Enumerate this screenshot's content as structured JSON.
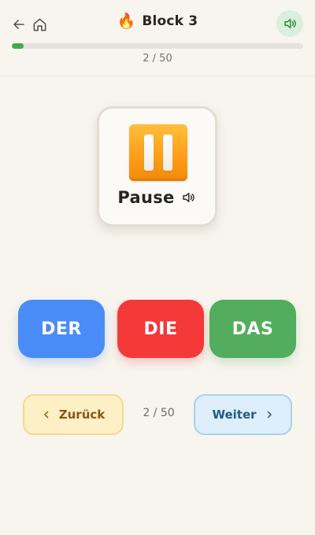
{
  "header": {
    "back_icon": "arrow-left-icon",
    "home_icon": "home-icon",
    "title_emoji": "🔥",
    "title": "Block 3",
    "sound_icon": "speaker-icon",
    "progress_fraction": 0.04,
    "progress_text": "2 / 50"
  },
  "card": {
    "image": "pause-button-emoji",
    "word": "Pause",
    "sound_icon": "speaker-icon"
  },
  "articles": {
    "der": "DER",
    "die": "DIE",
    "das": "DAS"
  },
  "nav": {
    "prev_label": "Zurück",
    "prev_icon": "chevron-left-icon",
    "counter": "2 / 50",
    "next_label": "Weiter",
    "next_icon": "chevron-right-icon"
  },
  "colors": {
    "background": "#f8f5ef",
    "progress": "#3cae4a",
    "der": "#4a8cf7",
    "die": "#f53838",
    "das": "#52ad5d",
    "prev_bg": "#fdf0c6",
    "next_bg": "#deeffb"
  }
}
